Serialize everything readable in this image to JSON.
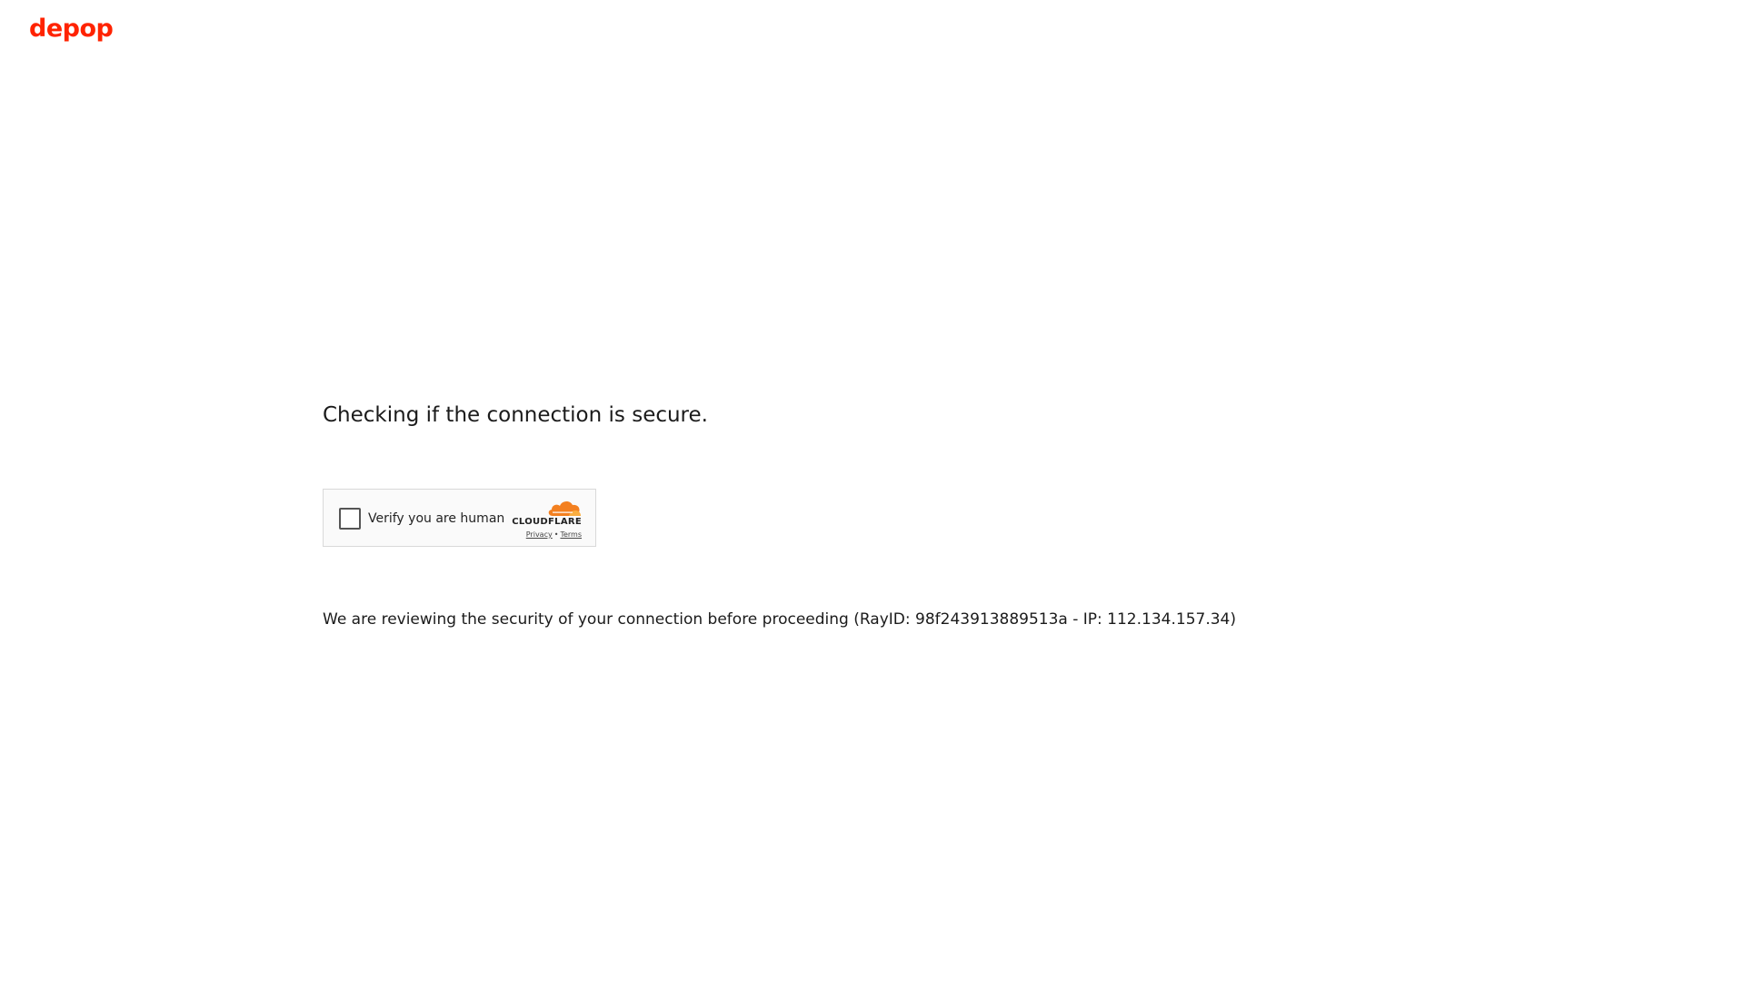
{
  "brand": {
    "logo_text": "depop",
    "logo_color": "#ff2300"
  },
  "main": {
    "heading": "Checking if the connection is secure.",
    "status_message": "We are reviewing the security of your connection before proceeding (RayID: 98f243913889513a - IP: 112.134.157.34)"
  },
  "challenge_widget": {
    "checkbox_checked": false,
    "label": "Verify you are human",
    "provider": "CLOUDFLARE",
    "privacy_link": "Privacy",
    "separator": "•",
    "terms_link": "Terms",
    "provider_icon": "cloudflare-cloud-icon",
    "accent_color": "#f38020"
  }
}
